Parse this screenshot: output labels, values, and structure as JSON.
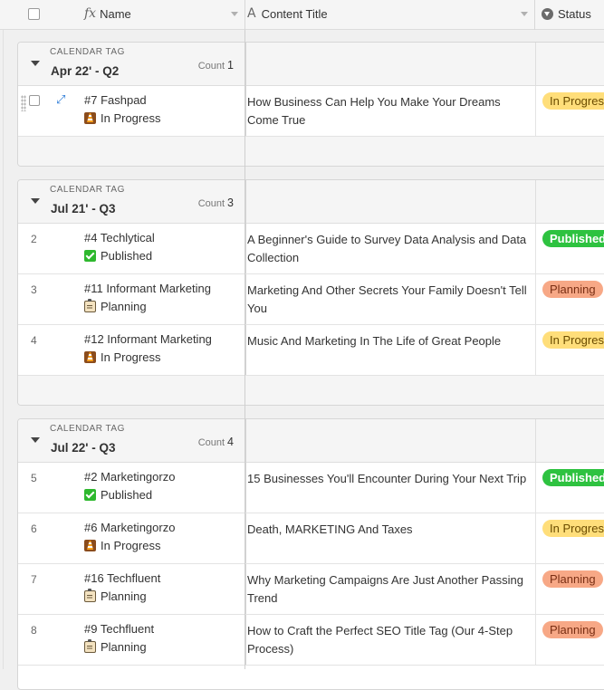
{
  "header": {
    "name_label": "Name",
    "name_icon": "fx-icon",
    "title_label": "Content Title",
    "title_icon": "text-a-icon",
    "status_label": "Status",
    "status_icon": "status-dropdown-icon"
  },
  "colors": {
    "published_bg": "#2ec240",
    "published_fg": "#ffffff",
    "planning_bg": "#f7a886",
    "planning_fg": "#7a2f14",
    "in_progress_bg": "#ffde7a",
    "in_progress_fg": "#6b4c00"
  },
  "groups": [
    {
      "field": "CALENDAR TAG",
      "value": "Apr 22' - Q2",
      "count_label": "Count",
      "count": "1",
      "rows": [
        {
          "num": "",
          "name": "#7 Fashpad",
          "stage": "In Progress",
          "stage_icon": "construction-icon",
          "title": "How Business Can Help You Make Your Dreams Come True",
          "status": "In Progress"
        }
      ]
    },
    {
      "field": "CALENDAR TAG",
      "value": "Jul 21' - Q3",
      "count_label": "Count",
      "count": "3",
      "rows": [
        {
          "num": "2",
          "name": "#4 Techlytical",
          "stage": "Published",
          "stage_icon": "check-icon",
          "title": "A Beginner's Guide to Survey Data Analysis and Data Collection",
          "status": "Published"
        },
        {
          "num": "3",
          "name": "#11 Informant Marketing",
          "stage": "Planning",
          "stage_icon": "clipboard-icon",
          "title": "Marketing And Other Secrets Your Family Doesn't Tell You",
          "status": "Planning"
        },
        {
          "num": "4",
          "name": "#12 Informant Marketing",
          "stage": "In Progress",
          "stage_icon": "construction-icon",
          "title": "Music And Marketing In The Life of Great People",
          "status": "In Progress"
        }
      ]
    },
    {
      "field": "CALENDAR TAG",
      "value": "Jul 22' - Q3",
      "count_label": "Count",
      "count": "4",
      "rows": [
        {
          "num": "5",
          "name": "#2 Marketingorzo",
          "stage": "Published",
          "stage_icon": "check-icon",
          "title": "15 Businesses You'll Encounter During Your Next Trip",
          "status": "Published"
        },
        {
          "num": "6",
          "name": "#6 Marketingorzo",
          "stage": "In Progress",
          "stage_icon": "construction-icon",
          "title": "Death, MARKETING And Taxes",
          "status": "In Progress"
        },
        {
          "num": "7",
          "name": "#16 Techfluent",
          "stage": "Planning",
          "stage_icon": "clipboard-icon",
          "title": "Why Marketing Campaigns Are Just Another Passing Trend",
          "status": "Planning"
        },
        {
          "num": "8",
          "name": "#9 Techfluent",
          "stage": "Planning",
          "stage_icon": "clipboard-icon",
          "title": "How to Craft the Perfect SEO Title Tag (Our 4-Step Process)",
          "status": "Planning"
        }
      ]
    }
  ]
}
